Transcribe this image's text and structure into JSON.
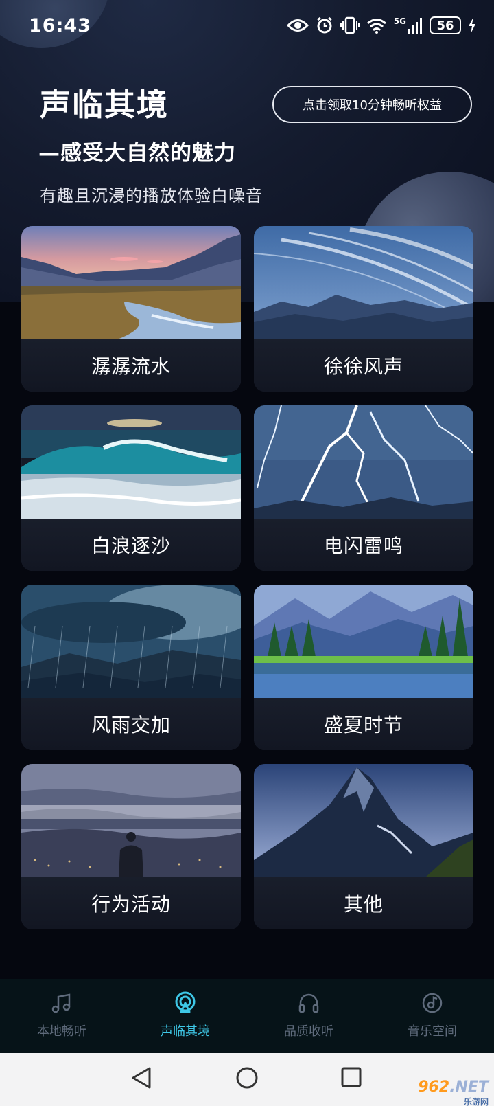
{
  "status_bar": {
    "time": "16:43",
    "network": "5G",
    "battery": "56"
  },
  "header": {
    "title": "声临其境",
    "promo_button": "点击领取10分钟畅听权益",
    "subtitle": "—感受大自然的魅力",
    "description": "有趣且沉浸的播放体验白噪音"
  },
  "scenes": [
    {
      "label": "潺潺流水",
      "image": "stream-meadow"
    },
    {
      "label": "徐徐风声",
      "image": "wind-streaks"
    },
    {
      "label": "白浪逐沙",
      "image": "ocean-wave"
    },
    {
      "label": "电闪雷鸣",
      "image": "lightning"
    },
    {
      "label": "风雨交加",
      "image": "rain-storm"
    },
    {
      "label": "盛夏时节",
      "image": "summer-lake"
    },
    {
      "label": "行为活动",
      "image": "misty-person"
    },
    {
      "label": "其他",
      "image": "mountain-peak"
    }
  ],
  "bottom_nav": [
    {
      "label": "本地畅听",
      "icon": "music-note-icon",
      "active": false
    },
    {
      "label": "声临其境",
      "icon": "broadcast-icon",
      "active": true
    },
    {
      "label": "品质收听",
      "icon": "headphones-icon",
      "active": false
    },
    {
      "label": "音乐空间",
      "icon": "music-disc-icon",
      "active": false
    }
  ],
  "watermark": {
    "number": "962",
    "suffix": ".NET",
    "text": "乐游网"
  },
  "colors": {
    "accent": "#3ec7e6",
    "inactive": "#5f6b7c",
    "background": "#05070f"
  }
}
